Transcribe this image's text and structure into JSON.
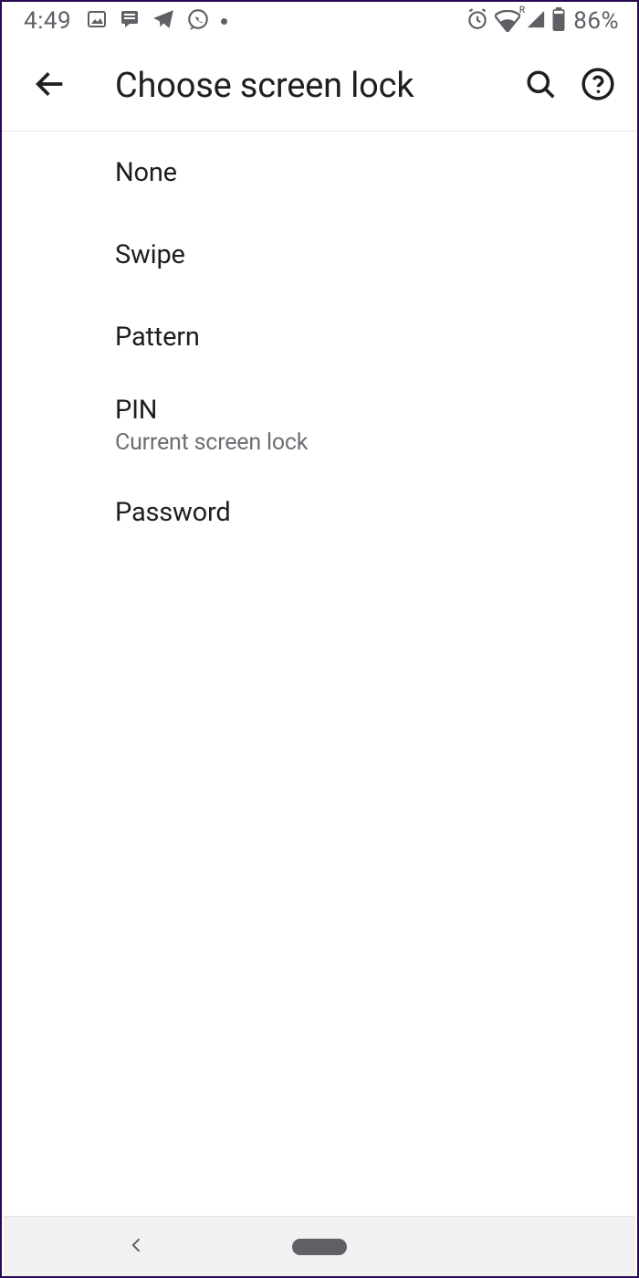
{
  "status": {
    "time": "4:49",
    "battery_percent": "86%",
    "wifi_badge": "R"
  },
  "header": {
    "title": "Choose screen lock"
  },
  "options": [
    {
      "label": "None",
      "sub": ""
    },
    {
      "label": "Swipe",
      "sub": ""
    },
    {
      "label": "Pattern",
      "sub": ""
    },
    {
      "label": "PIN",
      "sub": "Current screen lock"
    },
    {
      "label": "Password",
      "sub": ""
    }
  ]
}
